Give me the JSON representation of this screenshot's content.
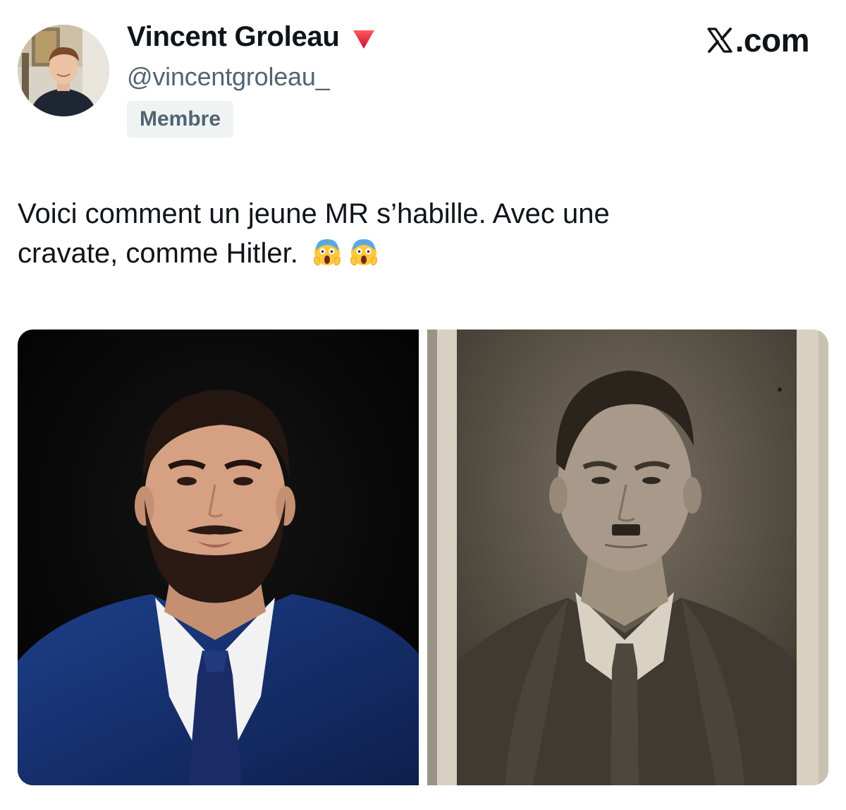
{
  "post": {
    "author": {
      "name": "Vincent Groleau",
      "handle": "@vincentgroleau_",
      "badge": "Membre",
      "flag_icon": "red-down-triangle-icon",
      "flag_color": "#e0245e"
    },
    "site_logo": ".com",
    "site_logo_icon": "x-logo-icon",
    "text_line1": "Voici comment un jeune MR s’habille. Avec une",
    "text_line2": "cravate, comme Hitler.",
    "emojis": [
      "screaming-face-icon",
      "screaming-face-icon"
    ],
    "media": [
      {
        "kind": "photo",
        "description_icon": "portrait-photo-left"
      },
      {
        "kind": "photo",
        "description_icon": "portrait-photo-right"
      }
    ]
  },
  "colors": {
    "text": "#0f1419",
    "muted": "#536471",
    "badge_bg": "#eff3f4",
    "accent_red": "#e0245e"
  }
}
